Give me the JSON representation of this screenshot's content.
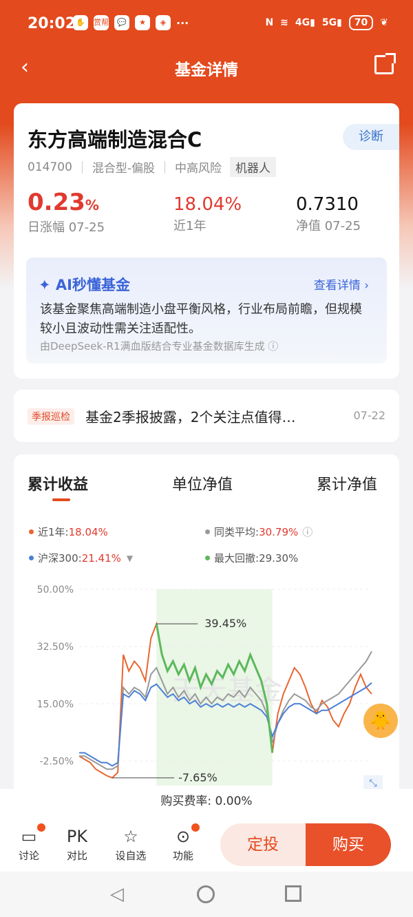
{
  "status_bar": {
    "time": "20:02",
    "battery": "70",
    "notif_badge": "赏帮"
  },
  "nav": {
    "title": "基金详情"
  },
  "fund": {
    "name": "东方高端制造混合C",
    "diagnose": "诊断",
    "code": "014700",
    "type": "混合型-偏股",
    "risk": "中高风险",
    "robot": "机器人",
    "daily_change_value": "0.23",
    "daily_change_unit": "%",
    "daily_change_label": "日涨幅 07-25",
    "year_return": "18.04%",
    "year_return_label": "近1年",
    "nav_value": "0.7310",
    "nav_label": "净值 07-25"
  },
  "ai": {
    "title": "AI秒懂基金",
    "more": "查看详情 ›",
    "text": "该基金聚焦高端制造小盘平衡风格，行业布局前瞻，但规模较小且波动性需关注适配性。",
    "source": "由DeepSeek-R1满血版结合专业基金数据库生成 ⓘ"
  },
  "report": {
    "tag": "季报巡检",
    "text": "基金2季报披露，2个关注点值得…",
    "date": "07-22"
  },
  "chart_tabs": [
    "累计收益",
    "单位净值",
    "累计净值"
  ],
  "legend": [
    {
      "label": "近1年:",
      "value": "18.04%",
      "color": "#e8662f"
    },
    {
      "label": "同类平均:",
      "value": "30.79%",
      "color": "#999999"
    },
    {
      "label": "沪深300:",
      "value": "21.41%",
      "color": "#4a7fd6"
    },
    {
      "label": "最大回撤:",
      "value": "29.30%",
      "color": "#5cb85c"
    }
  ],
  "chart_data": {
    "type": "line",
    "yticks": [
      "50.00%",
      "32.50%",
      "15.00%",
      "-2.50%"
    ],
    "ylim": [
      -10,
      50
    ],
    "annotations": [
      "39.45%",
      "-7.65%"
    ],
    "watermark": "天天基金",
    "series": [
      {
        "name": "近1年",
        "color": "#e8662f",
        "values": [
          -1,
          -2,
          -3,
          -5,
          -6,
          -7,
          -7.65,
          -6,
          30,
          25,
          28,
          26,
          22,
          35,
          39.45,
          30,
          25,
          28,
          24,
          27,
          22,
          26,
          20,
          24,
          21,
          25,
          23,
          27,
          24,
          28,
          25,
          30,
          26,
          22,
          15,
          0,
          12,
          18,
          22,
          26,
          24,
          20,
          15,
          12,
          16,
          14,
          10,
          8,
          12,
          15,
          20,
          24,
          20,
          18
        ]
      },
      {
        "name": "同类平均",
        "color": "#999999",
        "values": [
          -1,
          -1,
          -2,
          -3,
          -4,
          -5,
          -5,
          -4,
          20,
          18,
          20,
          19,
          17,
          24,
          26,
          22,
          18,
          20,
          17,
          19,
          16,
          18,
          15,
          17,
          15,
          17,
          16,
          18,
          17,
          19,
          17,
          20,
          18,
          16,
          12,
          3,
          9,
          13,
          16,
          18,
          17,
          16,
          14,
          13,
          15,
          16,
          17,
          18,
          20,
          22,
          24,
          26,
          28,
          31
        ]
      },
      {
        "name": "沪深300",
        "color": "#4a7fd6",
        "values": [
          0,
          0,
          -1,
          -2,
          -3,
          -3,
          -4,
          -3,
          18,
          17,
          19,
          18,
          16,
          20,
          21,
          19,
          17,
          18,
          16,
          17,
          15,
          16,
          14,
          15,
          14,
          15,
          14,
          15,
          14,
          15,
          14,
          15,
          14,
          13,
          11,
          5,
          9,
          12,
          14,
          15,
          15,
          14,
          13,
          12,
          13,
          13,
          14,
          15,
          16,
          17,
          18,
          19,
          20,
          21.41
        ]
      }
    ],
    "drawdown_range": [
      14,
      35
    ]
  },
  "fee": "购买费率: 0.00%",
  "bottom": {
    "items": [
      {
        "icon": "chat-icon",
        "label": "讨论"
      },
      {
        "icon": "pk-icon",
        "label": "对比",
        "text": "PK"
      },
      {
        "icon": "star-icon",
        "label": "设自选"
      },
      {
        "icon": "more-icon",
        "label": "功能"
      }
    ],
    "plan": "定投",
    "buy": "购买"
  }
}
